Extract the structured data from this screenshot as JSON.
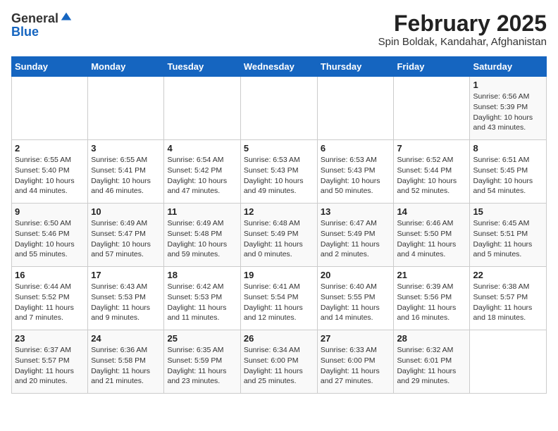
{
  "header": {
    "logo_general": "General",
    "logo_blue": "Blue",
    "title": "February 2025",
    "subtitle": "Spin Boldak, Kandahar, Afghanistan"
  },
  "weekdays": [
    "Sunday",
    "Monday",
    "Tuesday",
    "Wednesday",
    "Thursday",
    "Friday",
    "Saturday"
  ],
  "weeks": [
    [
      {
        "day": "",
        "info": ""
      },
      {
        "day": "",
        "info": ""
      },
      {
        "day": "",
        "info": ""
      },
      {
        "day": "",
        "info": ""
      },
      {
        "day": "",
        "info": ""
      },
      {
        "day": "",
        "info": ""
      },
      {
        "day": "1",
        "info": "Sunrise: 6:56 AM\nSunset: 5:39 PM\nDaylight: 10 hours and 43 minutes."
      }
    ],
    [
      {
        "day": "2",
        "info": "Sunrise: 6:55 AM\nSunset: 5:40 PM\nDaylight: 10 hours and 44 minutes."
      },
      {
        "day": "3",
        "info": "Sunrise: 6:55 AM\nSunset: 5:41 PM\nDaylight: 10 hours and 46 minutes."
      },
      {
        "day": "4",
        "info": "Sunrise: 6:54 AM\nSunset: 5:42 PM\nDaylight: 10 hours and 47 minutes."
      },
      {
        "day": "5",
        "info": "Sunrise: 6:53 AM\nSunset: 5:43 PM\nDaylight: 10 hours and 49 minutes."
      },
      {
        "day": "6",
        "info": "Sunrise: 6:53 AM\nSunset: 5:43 PM\nDaylight: 10 hours and 50 minutes."
      },
      {
        "day": "7",
        "info": "Sunrise: 6:52 AM\nSunset: 5:44 PM\nDaylight: 10 hours and 52 minutes."
      },
      {
        "day": "8",
        "info": "Sunrise: 6:51 AM\nSunset: 5:45 PM\nDaylight: 10 hours and 54 minutes."
      }
    ],
    [
      {
        "day": "9",
        "info": "Sunrise: 6:50 AM\nSunset: 5:46 PM\nDaylight: 10 hours and 55 minutes."
      },
      {
        "day": "10",
        "info": "Sunrise: 6:49 AM\nSunset: 5:47 PM\nDaylight: 10 hours and 57 minutes."
      },
      {
        "day": "11",
        "info": "Sunrise: 6:49 AM\nSunset: 5:48 PM\nDaylight: 10 hours and 59 minutes."
      },
      {
        "day": "12",
        "info": "Sunrise: 6:48 AM\nSunset: 5:49 PM\nDaylight: 11 hours and 0 minutes."
      },
      {
        "day": "13",
        "info": "Sunrise: 6:47 AM\nSunset: 5:49 PM\nDaylight: 11 hours and 2 minutes."
      },
      {
        "day": "14",
        "info": "Sunrise: 6:46 AM\nSunset: 5:50 PM\nDaylight: 11 hours and 4 minutes."
      },
      {
        "day": "15",
        "info": "Sunrise: 6:45 AM\nSunset: 5:51 PM\nDaylight: 11 hours and 5 minutes."
      }
    ],
    [
      {
        "day": "16",
        "info": "Sunrise: 6:44 AM\nSunset: 5:52 PM\nDaylight: 11 hours and 7 minutes."
      },
      {
        "day": "17",
        "info": "Sunrise: 6:43 AM\nSunset: 5:53 PM\nDaylight: 11 hours and 9 minutes."
      },
      {
        "day": "18",
        "info": "Sunrise: 6:42 AM\nSunset: 5:53 PM\nDaylight: 11 hours and 11 minutes."
      },
      {
        "day": "19",
        "info": "Sunrise: 6:41 AM\nSunset: 5:54 PM\nDaylight: 11 hours and 12 minutes."
      },
      {
        "day": "20",
        "info": "Sunrise: 6:40 AM\nSunset: 5:55 PM\nDaylight: 11 hours and 14 minutes."
      },
      {
        "day": "21",
        "info": "Sunrise: 6:39 AM\nSunset: 5:56 PM\nDaylight: 11 hours and 16 minutes."
      },
      {
        "day": "22",
        "info": "Sunrise: 6:38 AM\nSunset: 5:57 PM\nDaylight: 11 hours and 18 minutes."
      }
    ],
    [
      {
        "day": "23",
        "info": "Sunrise: 6:37 AM\nSunset: 5:57 PM\nDaylight: 11 hours and 20 minutes."
      },
      {
        "day": "24",
        "info": "Sunrise: 6:36 AM\nSunset: 5:58 PM\nDaylight: 11 hours and 21 minutes."
      },
      {
        "day": "25",
        "info": "Sunrise: 6:35 AM\nSunset: 5:59 PM\nDaylight: 11 hours and 23 minutes."
      },
      {
        "day": "26",
        "info": "Sunrise: 6:34 AM\nSunset: 6:00 PM\nDaylight: 11 hours and 25 minutes."
      },
      {
        "day": "27",
        "info": "Sunrise: 6:33 AM\nSunset: 6:00 PM\nDaylight: 11 hours and 27 minutes."
      },
      {
        "day": "28",
        "info": "Sunrise: 6:32 AM\nSunset: 6:01 PM\nDaylight: 11 hours and 29 minutes."
      },
      {
        "day": "",
        "info": ""
      }
    ]
  ]
}
